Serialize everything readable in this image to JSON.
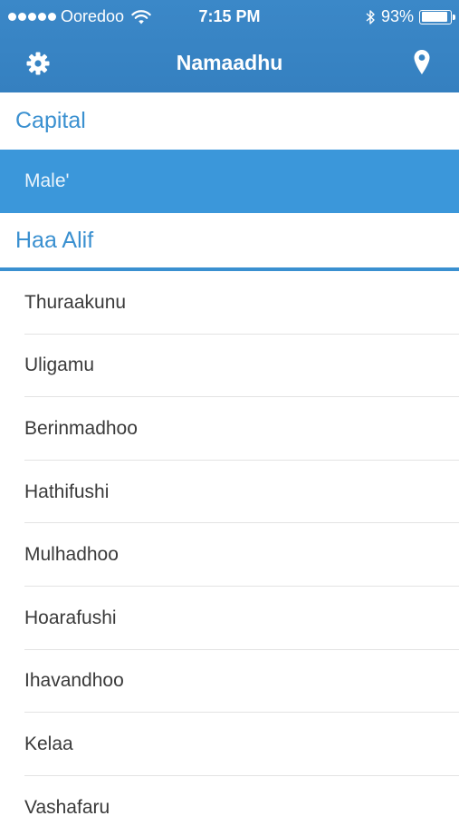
{
  "status_bar": {
    "carrier": "Ooredoo",
    "time": "7:15 PM",
    "battery": "93%",
    "battery_level": 0.93
  },
  "nav": {
    "title": "Namaadhu",
    "left_icon": "gear-icon",
    "right_icon": "location-pin-icon"
  },
  "colors": {
    "nav_bar": "#3a86c6",
    "accent": "#3a90d0",
    "selected_row": "#3b97da"
  },
  "sections": [
    {
      "header": "Capital",
      "rows": [
        "Male'"
      ],
      "selected": "Male'"
    },
    {
      "header": "Haa Alif",
      "rows": [
        "Thuraakunu",
        "Uligamu",
        "Berinmadhoo",
        "Hathifushi",
        "Mulhadhoo",
        "Hoarafushi",
        "Ihavandhoo",
        "Kelaa",
        "Vashafaru"
      ]
    }
  ]
}
